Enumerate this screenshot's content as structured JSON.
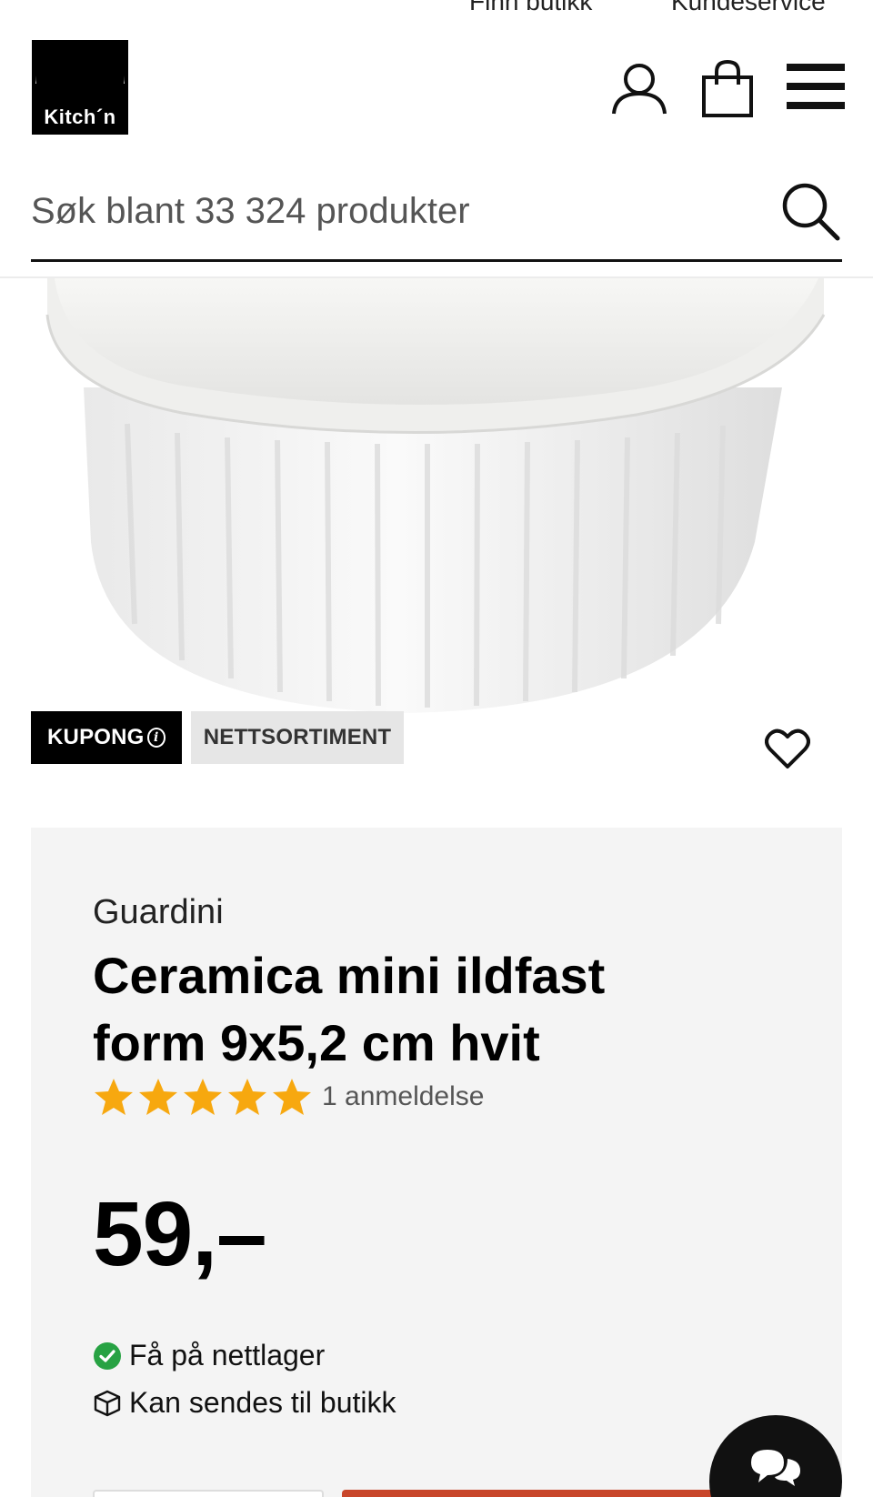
{
  "top_links": {
    "find_store": "Finn butikk",
    "customer_service": "Kundeservice"
  },
  "header": {
    "logo_text": "Kitch´n",
    "icons": [
      "user-icon",
      "shopping-bag-icon",
      "hamburger-menu-icon"
    ]
  },
  "search": {
    "placeholder": "Søk blant 33 324 produkter",
    "icon": "search-icon"
  },
  "product": {
    "image_alt": "Ceramica mini ildfast form 9x5,2 cm hvit",
    "badges": {
      "coupon": "KUPONG",
      "online_only": "NETTSORTIMENT"
    },
    "brand": "Guardini",
    "title": "Ceramica mini ildfast form 9x5,2 cm hvit",
    "rating": 5,
    "rating_max": 5,
    "review_count_label": "1 anmeldelse",
    "price": "59,–",
    "availability": {
      "online": "Få på nettlager",
      "store": "Kan sendes til butikk"
    }
  },
  "colors": {
    "star": "#f7a80f",
    "check": "#27a243",
    "buy_button": "#c8462a",
    "card_background": "#f4f4f4"
  }
}
